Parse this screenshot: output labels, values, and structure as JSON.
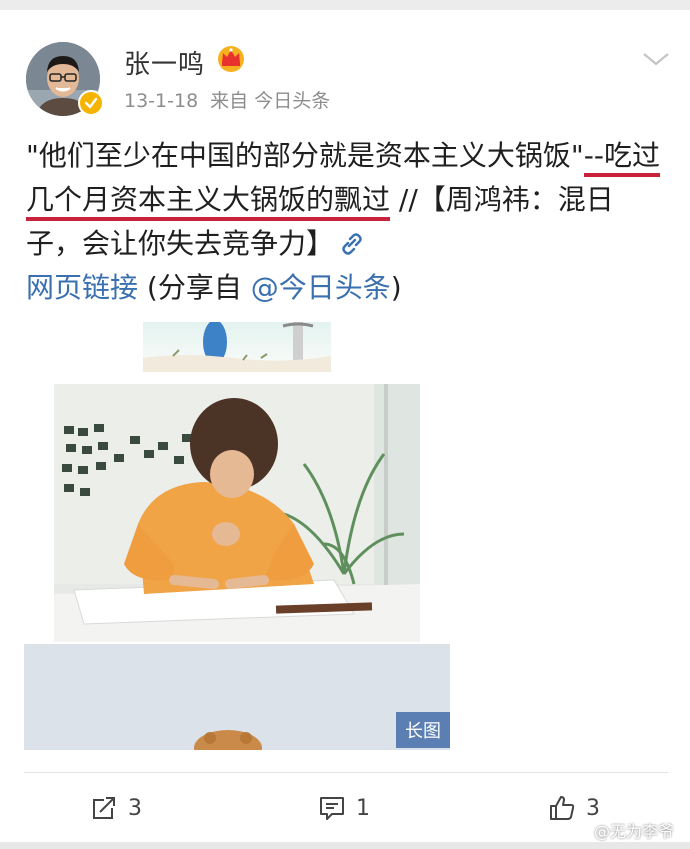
{
  "post": {
    "author": "张一鸣",
    "date": "13-1-18",
    "source": "来自 今日头条",
    "text_part1": "\"他们至少在中国的部分就是资本主义大锅饭\"",
    "text_highlight": "--吃过几个月资本主义大锅饭的飘过",
    "text_part2": " //【周鸿祎：混日子，会让你失去竞争力】",
    "link_label": "网页链接",
    "share_prefix": " (分享自 ",
    "share_target": "@今日头条",
    "share_suffix": ")",
    "long_image_badge": "长图"
  },
  "actions": {
    "repost_count": "3",
    "comment_count": "1",
    "like_count": "3"
  },
  "watermark": {
    "text": "@无为李爷"
  },
  "icons": {
    "verified": "verified-badge-icon",
    "crown": "crown-icon",
    "chevron": "chevron-down-icon",
    "link": "link-icon",
    "repost": "repost-icon",
    "comment": "comment-icon",
    "like": "thumbs-up-icon",
    "weibo": "weibo-logo-icon"
  },
  "colors": {
    "link_blue": "#3a6fb0",
    "underline_red": "#c8233a",
    "badge_blue": "#5b7fb2",
    "meta_gray": "#8d8d8d"
  }
}
